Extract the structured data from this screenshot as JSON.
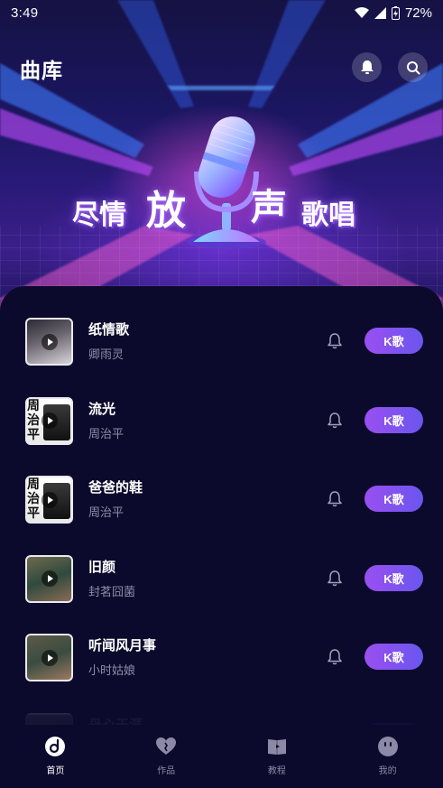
{
  "status_bar": {
    "time": "3:49",
    "battery": "72%"
  },
  "header": {
    "title": "曲库"
  },
  "banner": {
    "slogan_parts": [
      "尽情",
      "放",
      "声",
      "歌唱"
    ]
  },
  "songs": [
    {
      "title": "纸情歌",
      "artist": "卿雨灵",
      "action_label": "K歌",
      "cover_text": ""
    },
    {
      "title": "流光",
      "artist": "周治平",
      "action_label": "K歌",
      "cover_text": "周治平"
    },
    {
      "title": "爸爸的鞋",
      "artist": "周治平",
      "action_label": "K歌",
      "cover_text": "周治平"
    },
    {
      "title": "旧颜",
      "artist": "封茗囧菌",
      "action_label": "K歌",
      "cover_text": ""
    },
    {
      "title": "听闻风月事",
      "artist": "小时姑娘",
      "action_label": "K歌",
      "cover_text": ""
    },
    {
      "title": "丹心天涯",
      "artist": "",
      "action_label": "K歌",
      "cover_text": ""
    }
  ],
  "bottom_nav": [
    {
      "label": "首页",
      "icon": "home-disc-icon",
      "active": true
    },
    {
      "label": "作品",
      "icon": "heart-icon",
      "active": false
    },
    {
      "label": "教程",
      "icon": "book-icon",
      "active": false
    },
    {
      "label": "我的",
      "icon": "face-icon",
      "active": false
    }
  ],
  "colors": {
    "accent_start": "#9a4ff0",
    "accent_end": "#6a56ee",
    "background": "#0c0a2c"
  }
}
